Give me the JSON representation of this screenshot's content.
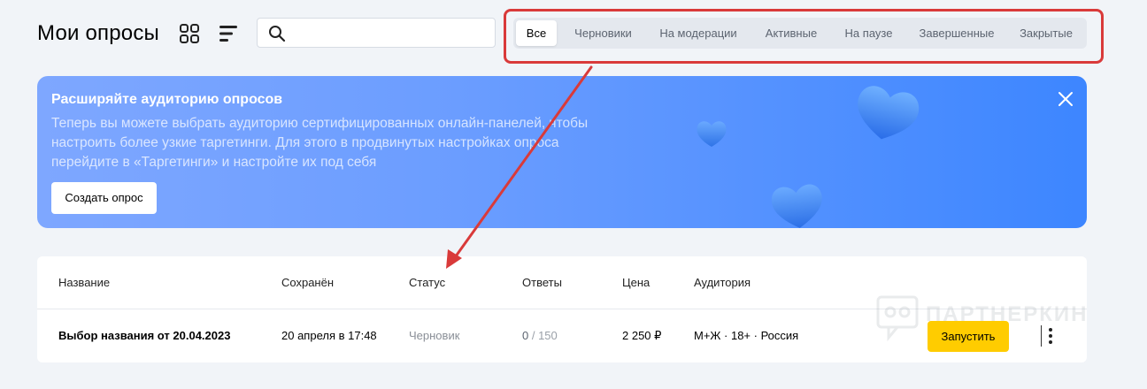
{
  "page": {
    "title": "Мои опросы"
  },
  "toolbar": {
    "grid_icon": "grid-view-icon",
    "list_icon": "list-view-icon",
    "search_icon": "search-icon",
    "search_value": "",
    "search_placeholder": ""
  },
  "filters": {
    "tabs": [
      {
        "label": "Все",
        "active": true
      },
      {
        "label": "Черновики",
        "active": false
      },
      {
        "label": "На модерации",
        "active": false
      },
      {
        "label": "Активные",
        "active": false
      },
      {
        "label": "На паузе",
        "active": false
      },
      {
        "label": "Завершенные",
        "active": false
      },
      {
        "label": "Закрытые",
        "active": false
      }
    ]
  },
  "banner": {
    "title": "Расширяйте аудиторию опросов",
    "text": "Теперь вы можете выбрать аудиторию сертифицированных онлайн-панелей, чтобы настроить более узкие таргетинги. Для этого в продвинутых настройках опроса перейдите в «Таргетинги» и настройте их под себя",
    "button_label": "Создать опрос",
    "close_icon": "close-icon"
  },
  "table": {
    "columns": [
      "Название",
      "Сохранён",
      "Статус",
      "Ответы",
      "Цена",
      "Аудитория"
    ],
    "rows": [
      {
        "name": "Выбор названия от 20.04.2023",
        "saved": "20 апреля в 17:48",
        "status": "Черновик",
        "answers_current": "0",
        "answers_total": " / 150",
        "price": "2 250 ₽",
        "audience": "М+Ж · 18+ · Россия",
        "action_label": "Запустить",
        "more_icon": "more-vertical-icon"
      }
    ]
  },
  "watermark": {
    "text": "ПАРТНЕРКИН"
  },
  "colors": {
    "page_bg": "#f1f4f8",
    "highlight": "#d93a3a",
    "banner_from": "#7ea7ff",
    "banner_to": "#3d86ff",
    "launch_button": "#ffcc00"
  }
}
